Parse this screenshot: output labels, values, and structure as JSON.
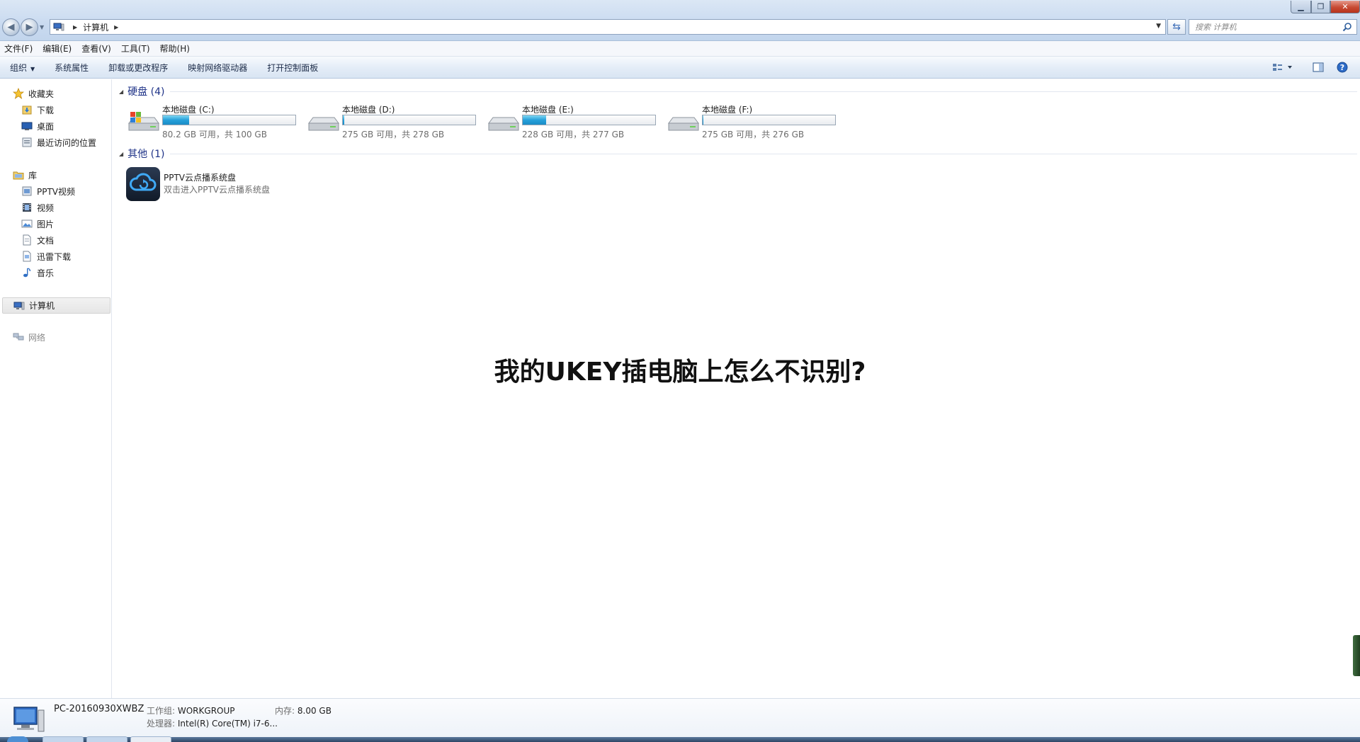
{
  "window": {
    "address_path": "计算机",
    "search_placeholder": "搜索 计算机"
  },
  "menu": [
    "文件(F)",
    "编辑(E)",
    "查看(V)",
    "工具(T)",
    "帮助(H)"
  ],
  "command_bar": {
    "organize": "组织",
    "items": [
      "系统属性",
      "卸载或更改程序",
      "映射网络驱动器",
      "打开控制面板"
    ]
  },
  "sidebar": {
    "favorites": {
      "label": "收藏夹",
      "items": [
        "下载",
        "桌面",
        "最近访问的位置"
      ]
    },
    "libraries": {
      "label": "库",
      "items": [
        "PPTV视频",
        "视频",
        "图片",
        "文档",
        "迅雷下载",
        "音乐"
      ]
    },
    "computer": "计算机",
    "network": "网络"
  },
  "groups": {
    "hard_disks": "硬盘 (4)",
    "other": "其他 (1)"
  },
  "drives": [
    {
      "name": "本地磁盘 (C:)",
      "size_text": "80.2 GB 可用，共 100 GB",
      "used_fraction": 0.198
    },
    {
      "name": "本地磁盘 (D:)",
      "size_text": "275 GB 可用，共 278 GB",
      "used_fraction": 0.011
    },
    {
      "name": "本地磁盘 (E:)",
      "size_text": "228 GB 可用，共 277 GB",
      "used_fraction": 0.177
    },
    {
      "name": "本地磁盘 (F:)",
      "size_text": "275 GB 可用，共 276 GB",
      "used_fraction": 0.004
    }
  ],
  "other_item": {
    "name": "PPTV云点播系统盘",
    "description": "双击进入PPTV云点播系统盘"
  },
  "overlay_title": "我的UKEY插电脑上怎么不识别?",
  "details": {
    "pc_name": "PC-20160930XWBZ",
    "workgroup_label": "工作组:",
    "workgroup_value": "WORKGROUP",
    "memory_label": "内存:",
    "memory_value": "8.00 GB",
    "cpu_label": "处理器:",
    "cpu_value": "Intel(R) Core(TM) i7-6..."
  },
  "colors": {
    "group_title": "#1e3287",
    "drive_fill": "#26a0da",
    "close_button": "#c74a33"
  }
}
